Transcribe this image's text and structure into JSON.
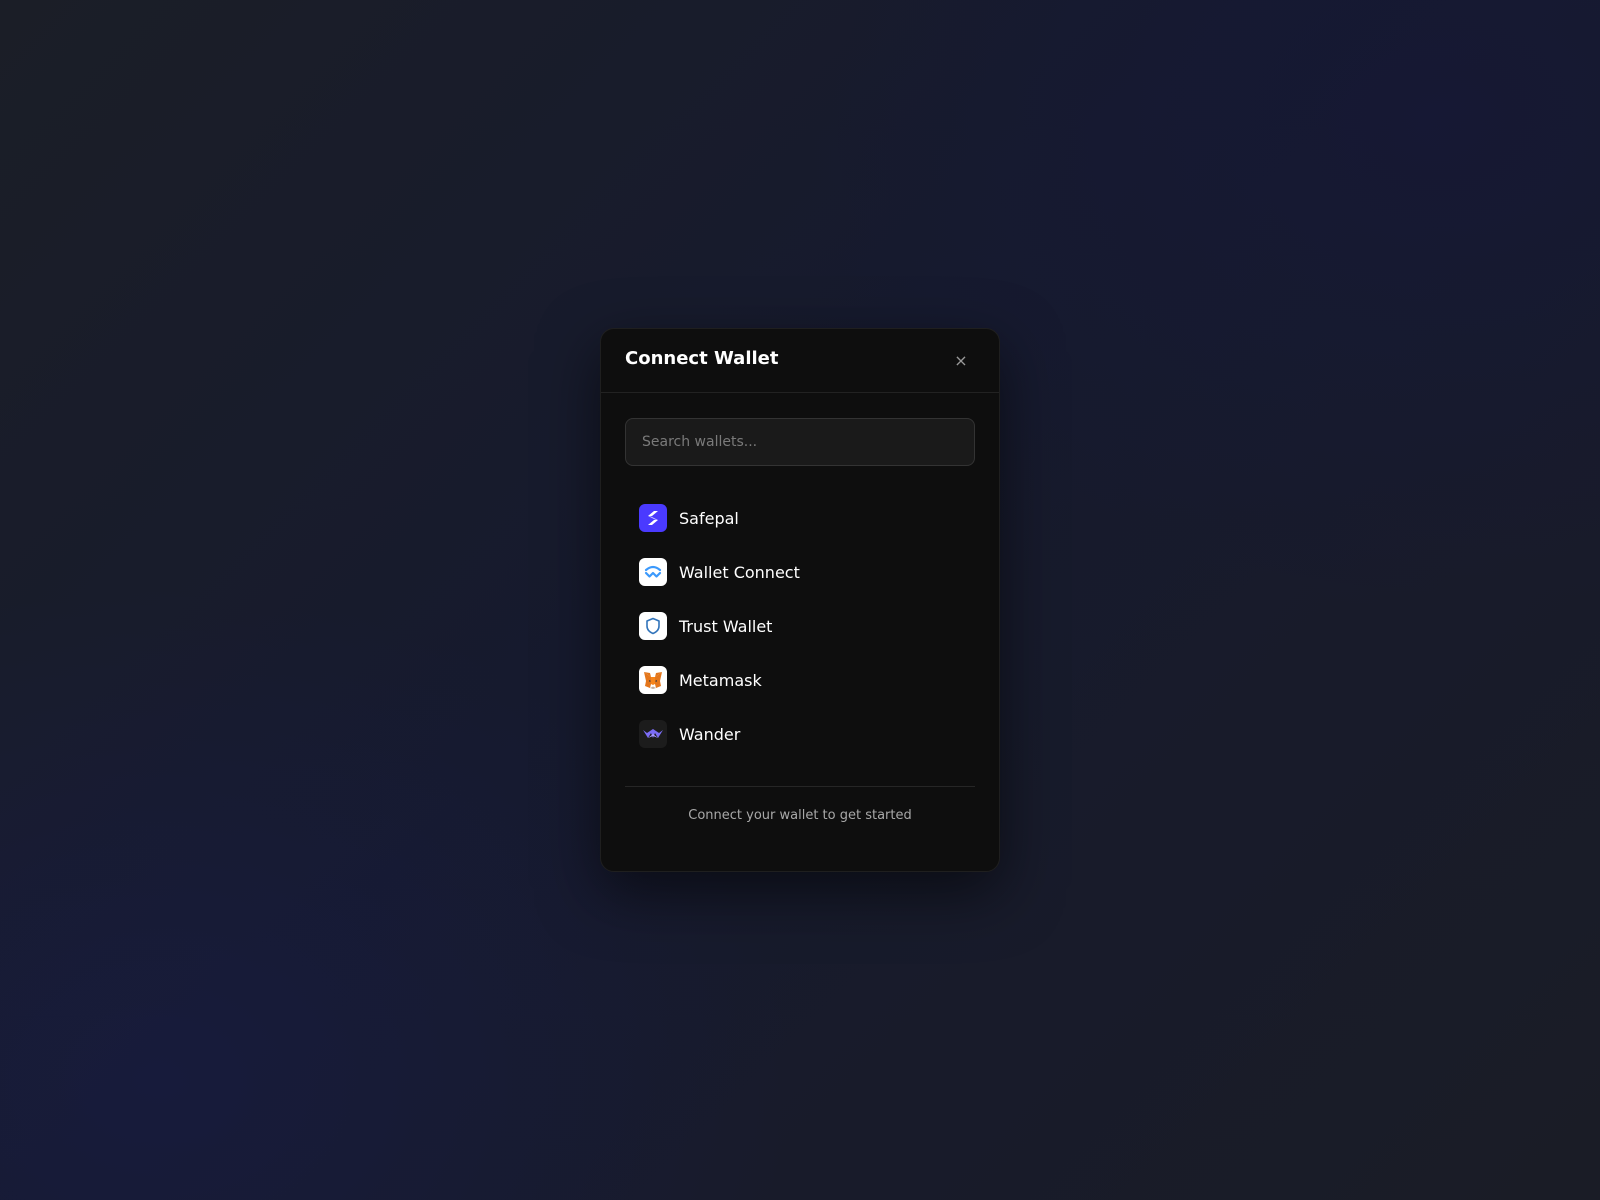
{
  "modal": {
    "title": "Connect Wallet",
    "close_label": "×",
    "search_placeholder": "Search wallets...",
    "footer": "Connect your wallet to get started"
  },
  "wallets": [
    {
      "label": "Safepal",
      "icon": "safepal-icon",
      "icon_bg": "#4a3aff"
    },
    {
      "label": "Wallet Connect",
      "icon": "walletconnect-icon",
      "icon_bg": "#ffffff"
    },
    {
      "label": "Trust Wallet",
      "icon": "trust-wallet-shield-icon",
      "icon_bg": "#ffffff"
    },
    {
      "label": "Metamask",
      "icon": "metamask-fox-icon",
      "icon_bg": "#ffffff"
    },
    {
      "label": "Wander",
      "icon": "wander-icon",
      "icon_bg": "#1c1c1c"
    }
  ],
  "colors": {
    "modal_bg": "#0e0e0e",
    "text": "#ffffff",
    "muted": "#a8a8a8"
  }
}
